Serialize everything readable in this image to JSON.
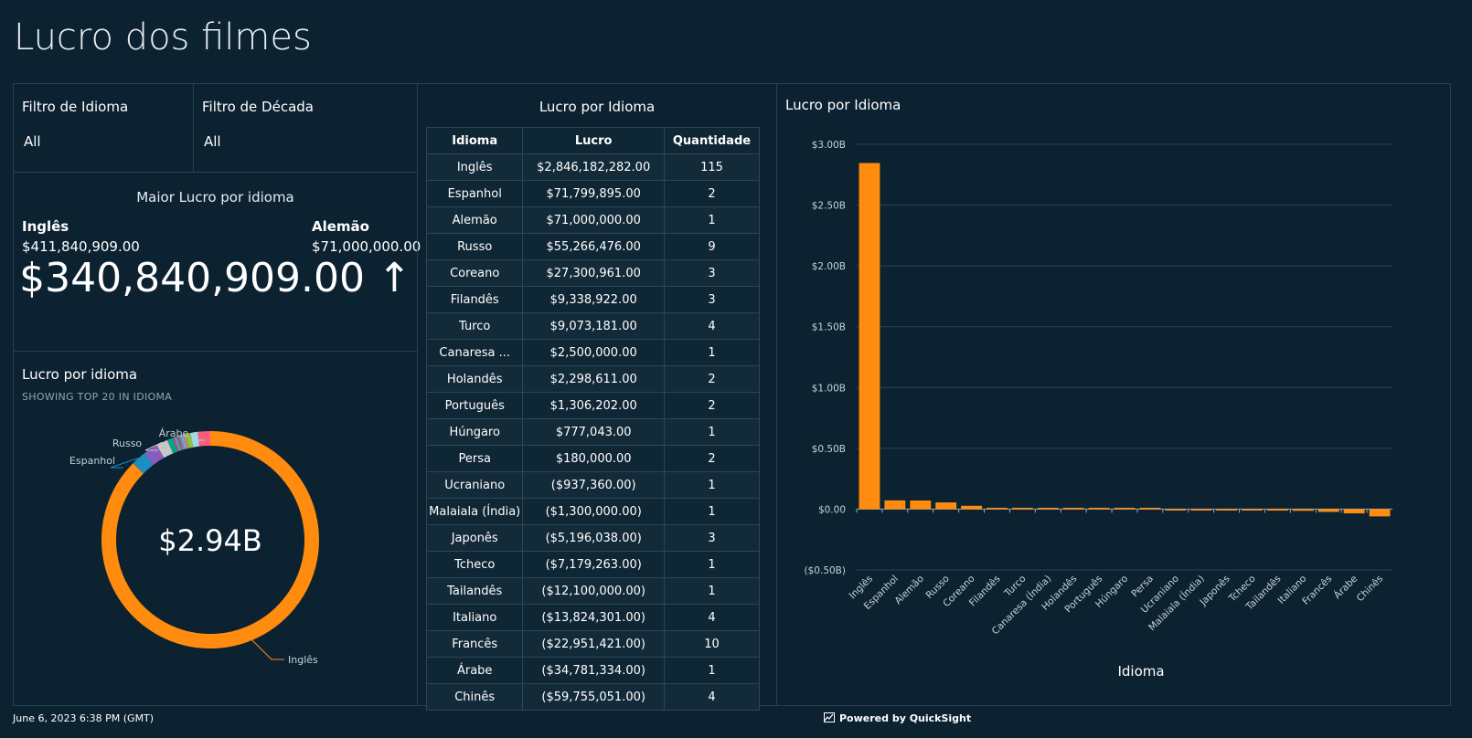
{
  "page": {
    "title": "Lucro dos filmes"
  },
  "filters": [
    {
      "label": "Filtro de Idioma",
      "value": "All"
    },
    {
      "label": "Filtro de Década",
      "value": "All"
    }
  ],
  "kpi": {
    "title": "Maior Lucro por idioma",
    "left_label": "Inglês",
    "left_value": "$411,840,909.00",
    "right_label": "Alemão",
    "right_value": "$71,000,000.00",
    "big_value": "$340,840,909.00 ↑"
  },
  "donut": {
    "title": "Lucro por idioma",
    "subtitle": "SHOWING TOP 20 IN IDIOMA",
    "center_label": "$2.94B",
    "callouts": [
      "Árabe",
      "Russo",
      "Espanhol",
      "Inglês"
    ]
  },
  "table": {
    "title": "Lucro por Idioma",
    "columns": [
      "Idioma",
      "Lucro",
      "Quantidade"
    ],
    "rows": [
      [
        "Inglês",
        "$2,846,182,282.00",
        "115"
      ],
      [
        "Espanhol",
        "$71,799,895.00",
        "2"
      ],
      [
        "Alemão",
        "$71,000,000.00",
        "1"
      ],
      [
        "Russo",
        "$55,266,476.00",
        "9"
      ],
      [
        "Coreano",
        "$27,300,961.00",
        "3"
      ],
      [
        "Filandês",
        "$9,338,922.00",
        "3"
      ],
      [
        "Turco",
        "$9,073,181.00",
        "4"
      ],
      [
        "Canaresa ...",
        "$2,500,000.00",
        "1"
      ],
      [
        "Holandês",
        "$2,298,611.00",
        "2"
      ],
      [
        "Português",
        "$1,306,202.00",
        "2"
      ],
      [
        "Húngaro",
        "$777,043.00",
        "1"
      ],
      [
        "Persa",
        "$180,000.00",
        "2"
      ],
      [
        "Ucraniano",
        "($937,360.00)",
        "1"
      ],
      [
        "Malaiala (Índia)",
        "($1,300,000.00)",
        "1"
      ],
      [
        "Japonês",
        "($5,196,038.00)",
        "3"
      ],
      [
        "Tcheco",
        "($7,179,263.00)",
        "1"
      ],
      [
        "Tailandês",
        "($12,100,000.00)",
        "1"
      ],
      [
        "Italiano",
        "($13,824,301.00)",
        "4"
      ],
      [
        "Francês",
        "($22,951,421.00)",
        "10"
      ],
      [
        "Árabe",
        "($34,781,334.00)",
        "1"
      ],
      [
        "Chinês",
        "($59,755,051.00)",
        "4"
      ]
    ]
  },
  "chart_data": [
    {
      "type": "pie",
      "title": "Lucro por idioma",
      "subtitle": "SHOWING TOP 20 IN IDIOMA",
      "center_label": "$2.94B",
      "categories": [
        "Inglês",
        "Espanhol",
        "Alemão",
        "Russo",
        "Coreano",
        "Filandês",
        "Turco",
        "Canaresa (Índia)",
        "Holandês",
        "Português",
        "Húngaro",
        "Persa",
        "Ucraniano",
        "Malaiala (Índia)",
        "Japonês",
        "Tcheco",
        "Tailandês",
        "Italiano",
        "Francês",
        "Árabe",
        "Chinês"
      ],
      "values": [
        2846182282,
        71799895,
        71000000,
        55266476,
        27300961,
        9338922,
        9073181,
        2500000,
        2298611,
        1306202,
        777043,
        180000,
        937360,
        1300000,
        5196038,
        7179263,
        12100000,
        13824301,
        22951421,
        34781334,
        59755051
      ],
      "colors": [
        "#ff8c0f",
        "#1b8ec4",
        "#8a5cc0",
        "#c7c7c7",
        "#00a87e",
        "#d13c8a",
        "#3fb0c9",
        "#b8860b",
        "#5c7cfa",
        "#e36d75",
        "#4d9e5e",
        "#9f7ad6",
        "#e0b341",
        "#2bb3a0",
        "#c2519b",
        "#7b8ca0",
        "#6aa6e6",
        "#c98c55",
        "#8bc34a",
        "#a0d8e0",
        "#ff5c7a"
      ]
    },
    {
      "type": "bar",
      "title": "Lucro por Idioma",
      "xlabel": "Idioma",
      "ylabel": "",
      "ylim": [
        -500000000,
        3000000000
      ],
      "yticks": [
        "($0.50B)",
        "$0.00",
        "$0.50B",
        "$1.00B",
        "$1.50B",
        "$2.00B",
        "$2.50B",
        "$3.00B"
      ],
      "categories": [
        "Inglês",
        "Espanhol",
        "Alemão",
        "Russo",
        "Coreano",
        "Filandês",
        "Turco",
        "Canaresa (Índia)",
        "Holandês",
        "Português",
        "Húngaro",
        "Persa",
        "Ucraniano",
        "Malaiala (Índia)",
        "Japonês",
        "Tcheco",
        "Tailandês",
        "Italiano",
        "Francês",
        "Árabe",
        "Chinês"
      ],
      "values": [
        2846182282,
        71799895,
        71000000,
        55266476,
        27300961,
        9338922,
        9073181,
        2500000,
        2298611,
        1306202,
        777043,
        180000,
        -937360,
        -1300000,
        -5196038,
        -7179263,
        -12100000,
        -13824301,
        -22951421,
        -34781334,
        -59755051
      ],
      "color": "#ff8c0f",
      "grid": true
    }
  ],
  "footer": {
    "timestamp": "June 6, 2023 6:38 PM (GMT)",
    "powered": "Powered by QuickSight"
  }
}
